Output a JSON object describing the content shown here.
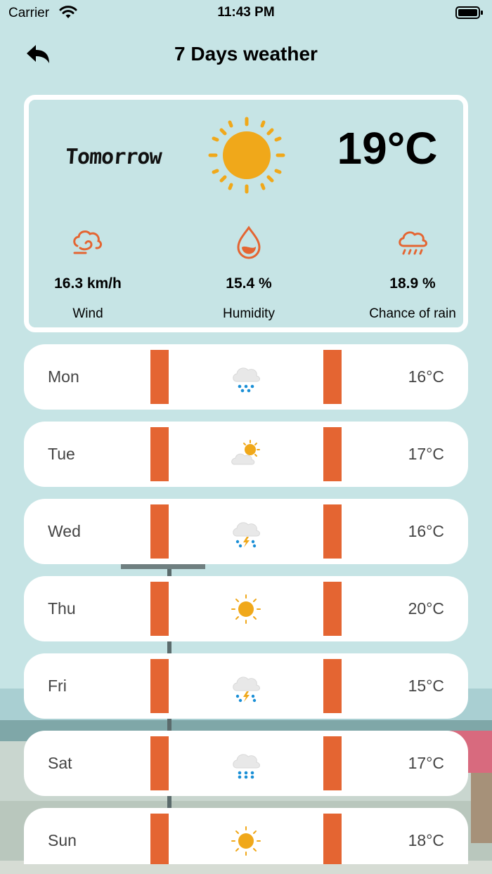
{
  "status_bar": {
    "carrier": "Carrier",
    "time": "11:43 PM"
  },
  "header": {
    "title": "7 Days weather",
    "back_icon": "back-arrow-icon"
  },
  "summary": {
    "day": "Tomorrow",
    "temperature": "19°C",
    "condition_icon": "sun-icon",
    "wind": {
      "value": "16.3 km/h",
      "label": "Wind",
      "icon": "wind-icon"
    },
    "humidity": {
      "value": "15.4 %",
      "label": "Humidity",
      "icon": "water-drop-icon"
    },
    "rain": {
      "value": "18.9 %",
      "label": "Chance of rain",
      "icon": "rain-cloud-icon"
    }
  },
  "days": [
    {
      "day": "Mon",
      "temp": "16°C",
      "icon": "rain-cloud-icon"
    },
    {
      "day": "Tue",
      "temp": "17°C",
      "icon": "partly-cloudy-icon"
    },
    {
      "day": "Wed",
      "temp": "16°C",
      "icon": "thunderstorm-icon"
    },
    {
      "day": "Thu",
      "temp": "20°C",
      "icon": "sun-icon"
    },
    {
      "day": "Fri",
      "temp": "15°C",
      "icon": "thunderstorm-icon"
    },
    {
      "day": "Sat",
      "temp": "17°C",
      "icon": "rain-cloud-icon"
    },
    {
      "day": "Sun",
      "temp": "18°C",
      "icon": "sun-icon"
    }
  ],
  "colors": {
    "background": "#c6e4e5",
    "accent": "#e46532",
    "sun": "#f0a81a",
    "rain": "#1a8fd6",
    "card": "#ffffff"
  }
}
